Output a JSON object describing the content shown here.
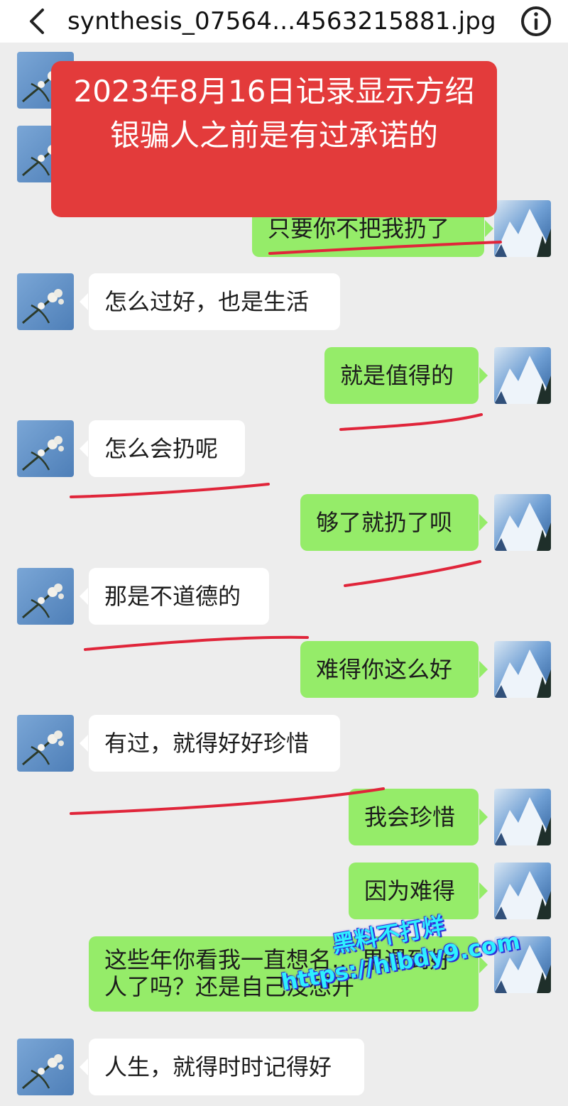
{
  "header": {
    "filename": "synthesis_07564...4563215881.jpg"
  },
  "banner": {
    "text": "2023年8月16日记录显示方绍银骗人之前是有过承诺的"
  },
  "messages": [
    {
      "side": "right",
      "text": "只要你不把我扔了"
    },
    {
      "side": "left",
      "text": "怎么过好，也是生活"
    },
    {
      "side": "right",
      "text": "就是值得的"
    },
    {
      "side": "left",
      "text": "怎么会扔呢"
    },
    {
      "side": "right",
      "text": "够了就扔了呗"
    },
    {
      "side": "left",
      "text": "那是不道德的"
    },
    {
      "side": "right",
      "text": "难得你这么好"
    },
    {
      "side": "left",
      "text": "有过，就得好好珍惜"
    },
    {
      "side": "right",
      "text": "我会珍惜"
    },
    {
      "side": "right",
      "text": "因为难得"
    },
    {
      "side": "right",
      "text": "这些年你看我一直想名… 果遇到好人了吗？还是自己没想开"
    },
    {
      "side": "left",
      "text": "人生，就得时时记得好"
    }
  ],
  "watermark": {
    "line1": "黑料不打烊",
    "line2": "https://hlbdy9.com"
  },
  "colors": {
    "bubble_green": "#95ec69",
    "bubble_white": "#ffffff",
    "banner_red": "#e33b3b",
    "underline_red": "#e0253a",
    "background": "#ededed"
  }
}
